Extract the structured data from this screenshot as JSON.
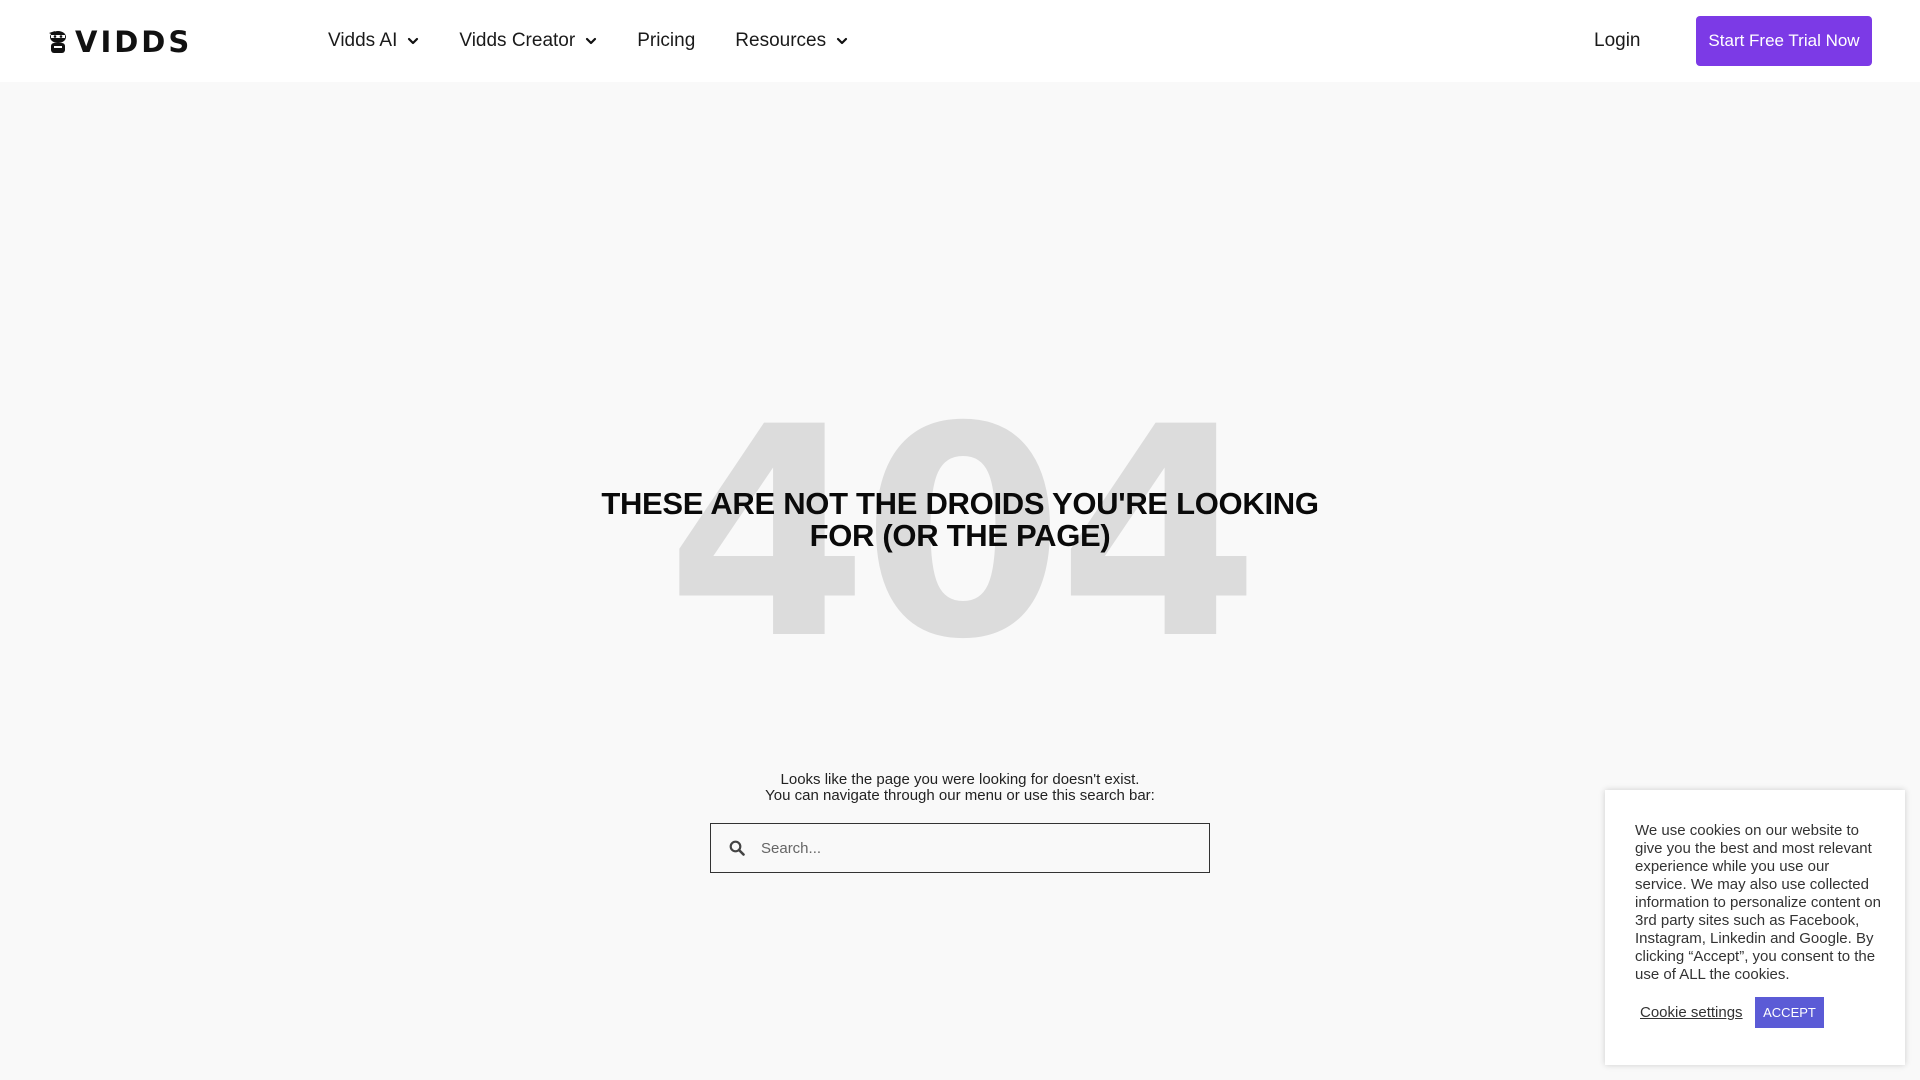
{
  "header": {
    "logo_text": "VIDDS",
    "nav": [
      {
        "label": "Vidds AI",
        "has_dropdown": true,
        "icon": "chevron-down-icon"
      },
      {
        "label": "Vidds Creator",
        "has_dropdown": true,
        "icon": "chevron-down-icon"
      },
      {
        "label": "Pricing",
        "has_dropdown": false
      },
      {
        "label": "Resources",
        "has_dropdown": true,
        "icon": "chevron-down-icon"
      }
    ],
    "login_label": "Login",
    "cta_label": "Start Free Trial Now"
  },
  "main": {
    "big_code": "404",
    "headline_line1": "THESE ARE NOT THE DROIDS YOU'RE LOOKING",
    "headline_line2": "FOR (OR THE PAGE)",
    "subtext_line1": "Looks like the page you were looking for doesn't exist.",
    "subtext_line2": "You can navigate through our menu or use this search bar:",
    "search": {
      "placeholder": "Search...",
      "value": "",
      "icon": "search-icon"
    }
  },
  "cookie": {
    "text": "We use cookies on our website to give you the best and most relevant experience while you use our service. We may also use collected information to personalize content on 3rd party sites such as Facebook, Instagram, Linkedin and Google. By clicking “Accept”, you consent to the use of ALL the cookies.",
    "settings_label": "Cookie settings",
    "accept_label": "ACCEPT"
  },
  "colors": {
    "accent": "#7c3ae6",
    "cookie_accept": "#5b5bd6",
    "big_code": "#dcdcdc",
    "background": "#f9f9f9"
  }
}
